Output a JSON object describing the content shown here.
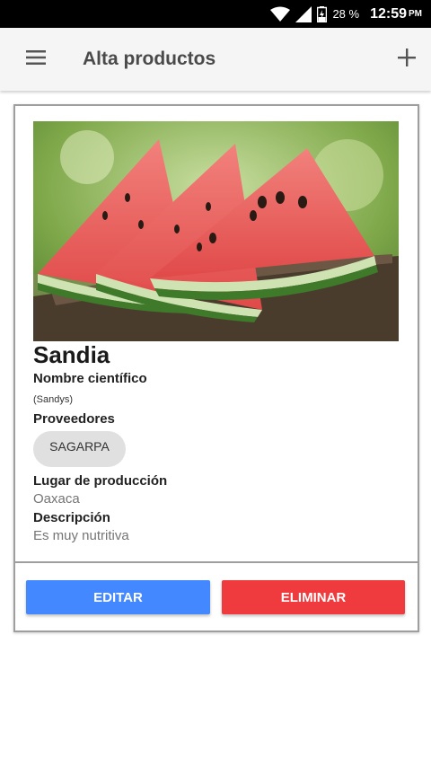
{
  "status_bar": {
    "battery_percent": "28 %",
    "time": "12:59",
    "ampm": "PM"
  },
  "app_bar": {
    "title": "Alta productos",
    "menu_icon": "hamburger-menu-icon",
    "add_icon": "plus-icon"
  },
  "product": {
    "name": "Sandia",
    "image": "watermelon-slices-photo",
    "scientific_name_label": "Nombre científico",
    "scientific_name": "(Sandys)",
    "suppliers_label": "Proveedores",
    "suppliers": [
      "SAGARPA"
    ],
    "production_place_label": "Lugar de producción",
    "production_place": "Oaxaca",
    "description_label": "Descripción",
    "description": "Es muy nutritiva"
  },
  "actions": {
    "edit_label": "EDITAR",
    "delete_label": "ELIMINAR"
  },
  "colors": {
    "edit_button": "#4488ff",
    "delete_button": "#ef3b3e",
    "chip_background": "#e0e0e0"
  }
}
